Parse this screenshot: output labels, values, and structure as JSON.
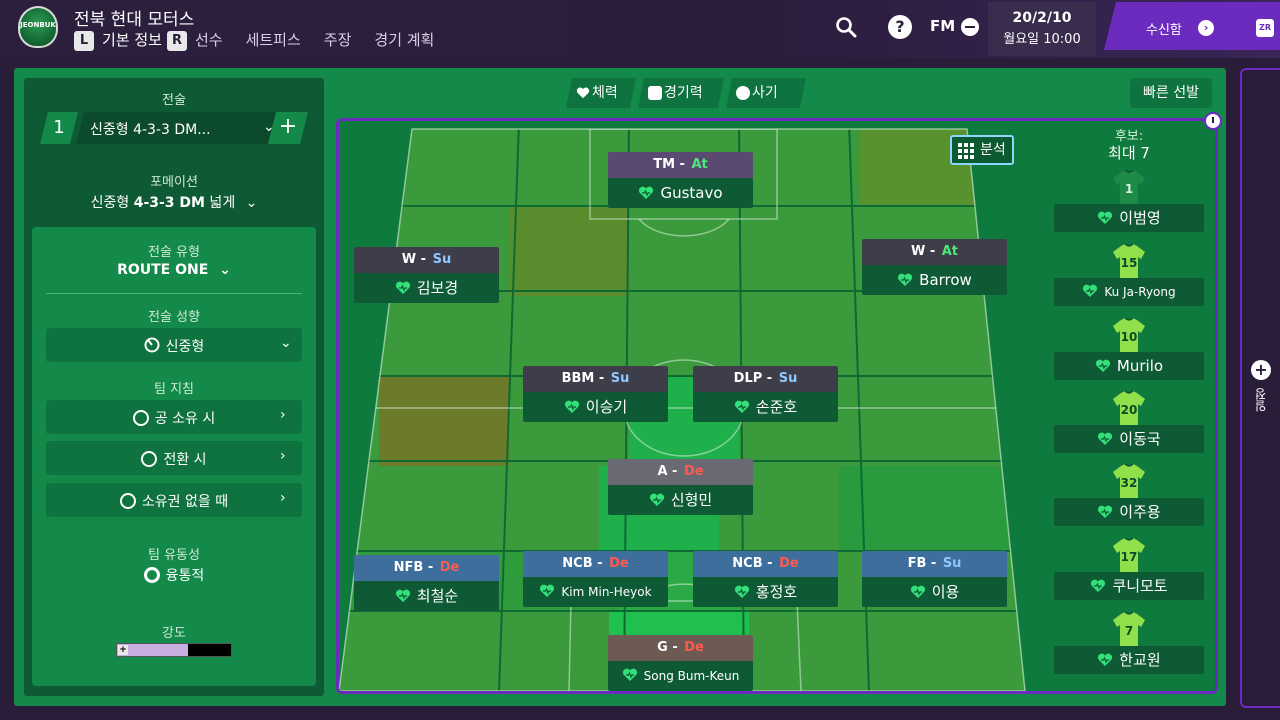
{
  "header": {
    "club_name": "전북 현대 모터스",
    "logo_text": "JEONBUK",
    "key_left": "L",
    "key_right": "R",
    "tabs": [
      {
        "label": "기본 정보"
      },
      {
        "label": "선수"
      },
      {
        "label": "세트피스"
      },
      {
        "label": "주장"
      },
      {
        "label": "경기 계획"
      }
    ],
    "fm_label": "FM",
    "date": "20/2/10",
    "day_time": "월요일 10:00",
    "inbox_label": "수신함",
    "zr_label": "ZR"
  },
  "right_tab": {
    "label": "일정"
  },
  "tactics_panel": {
    "tactic_heading": "전술",
    "tactic_number": "1",
    "tactic_name": "신중형 4-3-3 DM...",
    "formation_heading": "포메이션",
    "formation_prefix": "신중형 ",
    "formation_bold": "4-3-3 DM",
    "formation_suffix": " 넓게",
    "style_heading": "전술 유형",
    "style_value": "ROUTE ONE",
    "mentality_heading": "전술 성향",
    "mentality_value": "신중형",
    "instructions_heading": "팀 지침",
    "in_possession": "공 소유 시",
    "in_transition": "전환 시",
    "out_of_possession": "소유권 없을 때",
    "fluidity_heading": "팀 유동성",
    "fluidity_value": "융통적",
    "intensity_heading": "강도",
    "intensity_level": 0.62
  },
  "filter_tabs": [
    {
      "label": "체력"
    },
    {
      "label": "경기력"
    },
    {
      "label": "사기"
    }
  ],
  "quick_pick_label": "빠른 선발",
  "analysis_label": "분석",
  "players": [
    {
      "role": "TM",
      "duty": "At",
      "name": "Gustavo"
    },
    {
      "role": "W",
      "duty": "Su",
      "name": "김보경"
    },
    {
      "role": "W",
      "duty": "At",
      "name": "Barrow"
    },
    {
      "role": "BBM",
      "duty": "Su",
      "name": "이승기"
    },
    {
      "role": "DLP",
      "duty": "Su",
      "name": "손준호"
    },
    {
      "role": "A",
      "duty": "De",
      "name": "신형민"
    },
    {
      "role": "NFB",
      "duty": "De",
      "name": "최철순"
    },
    {
      "role": "NCB",
      "duty": "De",
      "name": "Kim Min-Heyok"
    },
    {
      "role": "NCB",
      "duty": "De",
      "name": "홍정호"
    },
    {
      "role": "FB",
      "duty": "Su",
      "name": "이용"
    },
    {
      "role": "G",
      "duty": "De",
      "name": "Song Bum-Keun"
    }
  ],
  "subs": {
    "heading": "후보:",
    "max_label": "최대 7",
    "list": [
      {
        "number": "1",
        "name": "이범영"
      },
      {
        "number": "15",
        "name": "Ku Ja-Ryong"
      },
      {
        "number": "10",
        "name": "Murilo"
      },
      {
        "number": "20",
        "name": "이동국"
      },
      {
        "number": "32",
        "name": "이주용"
      },
      {
        "number": "17",
        "name": "쿠니모토"
      },
      {
        "number": "7",
        "name": "한교원"
      }
    ]
  },
  "colors": {
    "accent_purple": "#6b2bbf",
    "panel_green": "#138a4a",
    "fitness_heart": "#33e07a",
    "duty_defend": "#ff5a4e",
    "duty_support": "#8fc7ff",
    "duty_attack": "#4dea7a"
  }
}
